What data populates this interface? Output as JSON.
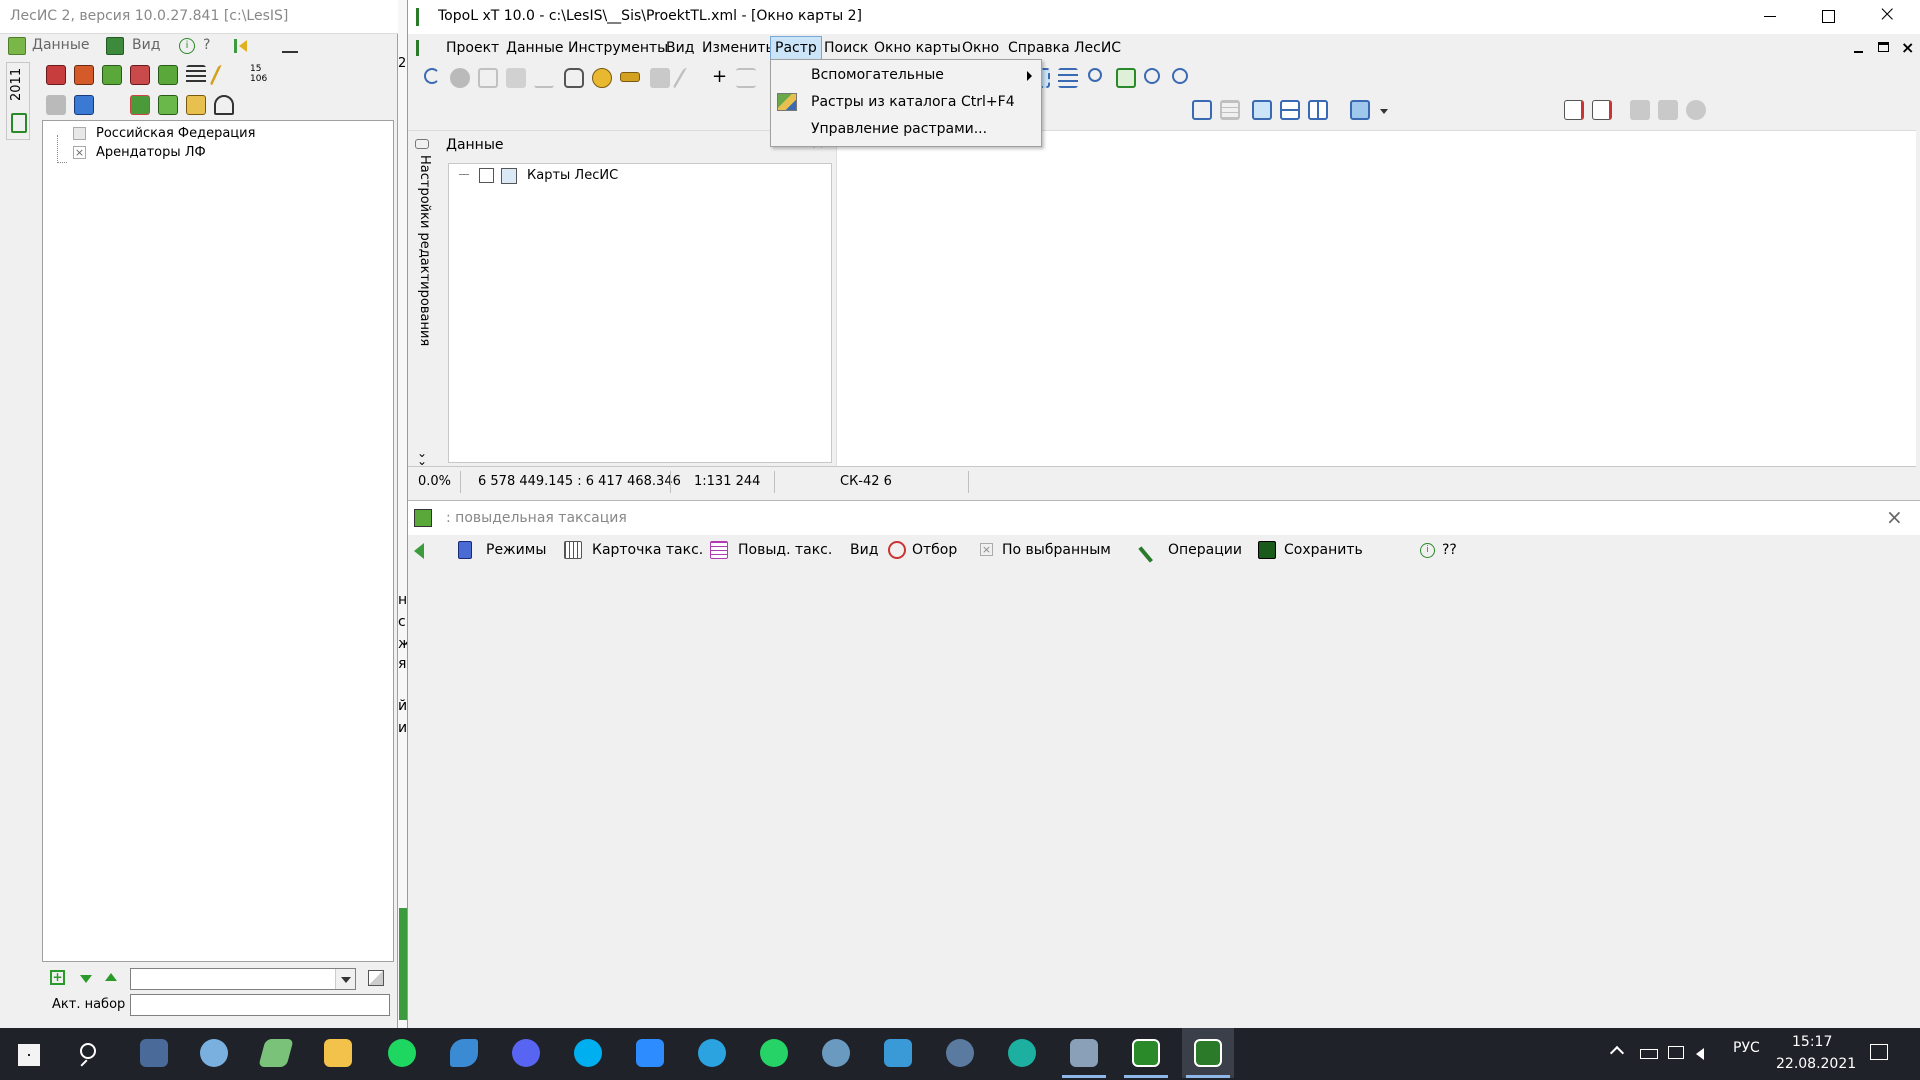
{
  "left_app": {
    "title": "ЛесИС 2, версия 10.0.27.841  [c:\\LesIS]",
    "menu": {
      "data": "Данные",
      "view": "Вид",
      "help": "?"
    },
    "vtab_year": "2011",
    "tree": [
      "Российская Федерация",
      "Арендаторы ЛФ"
    ],
    "act_label": "Акт. набор"
  },
  "topol": {
    "title": "TopoL xT 10.0 - c:\\LesIS\\__Sis\\ProektTL.xml - [Окно карты 2]",
    "menu": [
      "Проект",
      "Данные",
      "Инструменты",
      "Вид",
      "Изменить",
      "Растр",
      "Поиск",
      "Окно карты",
      "Окно",
      "Справка",
      "ЛесИС"
    ],
    "dropdown": [
      {
        "label": "Вспомогательные",
        "shortcut": "",
        "submenu": true
      },
      {
        "label": "Растры из каталога",
        "shortcut": "Ctrl+F4",
        "submenu": false
      },
      {
        "label": "Управление растрами...",
        "shortcut": "",
        "submenu": false
      }
    ],
    "data_panel": {
      "title": "Данные",
      "side_tab": "Настройки редактирования",
      "tree_item": "Карты ЛесИС"
    },
    "status": {
      "percent": "0.0%",
      "coords": "6 578 449.145 : 6 417 468.346",
      "scale": "1:131 244",
      "crs": "СК-42 6"
    }
  },
  "taxation": {
    "title": ": повыдельная таксация",
    "toolbar": [
      "Режимы",
      "Карточка такс.",
      "Повыд. такс.",
      "Вид",
      "Отбор",
      "По выбранным",
      "Операции",
      "Сохранить",
      "??"
    ]
  },
  "behind_fragments": [
    "2",
    "н",
    "с",
    "ж",
    "я",
    "й",
    "и"
  ],
  "taskbar": {
    "lang": "РУС",
    "time": "15:17",
    "date": "22.08.2021",
    "apps": [
      "calculator",
      "paint",
      "notepad",
      "explorer",
      "spotify",
      "app-blue",
      "discord",
      "skype",
      "zoom",
      "telegram",
      "whatsapp",
      "network-app",
      "maps",
      "search-app",
      "edge",
      "remote",
      "lesis",
      "topol"
    ]
  }
}
